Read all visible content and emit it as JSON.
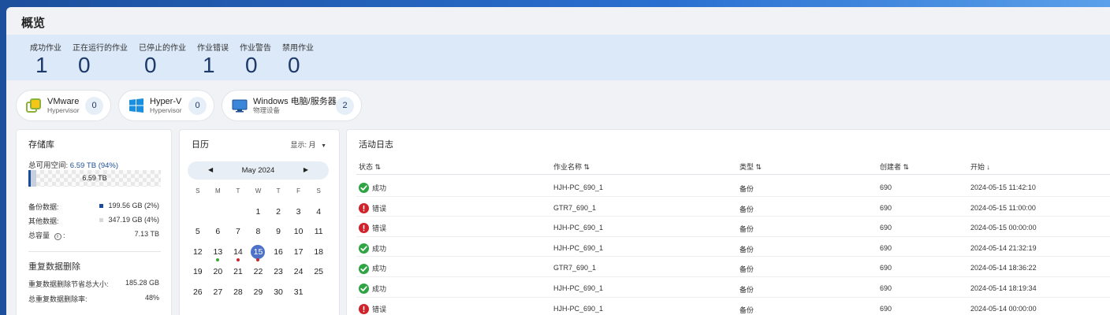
{
  "page": {
    "title": "概览"
  },
  "summary": [
    {
      "label": "成功作业",
      "value": "1"
    },
    {
      "label": "正在运行的作业",
      "value": "0"
    },
    {
      "label": "已停止的作业",
      "value": "0"
    },
    {
      "label": "作业错误",
      "value": "1"
    },
    {
      "label": "作业警告",
      "value": "0"
    },
    {
      "label": "禁用作业",
      "value": "0"
    }
  ],
  "hypervisors": [
    {
      "name": "VMware",
      "sub": "Hypervisor",
      "count": "0",
      "icon": "vmware-icon"
    },
    {
      "name": "Hyper-V",
      "sub": "Hypervisor",
      "count": "0",
      "icon": "windows-icon"
    },
    {
      "name": "Windows 电脑/服务器",
      "sub": "物理设备",
      "count": "2",
      "icon": "monitor-icon"
    }
  ],
  "storage": {
    "title": "存储库",
    "free_label": "总可用空间:",
    "free_value": "6.59 TB (94%)",
    "bar_text": "6.59 TB",
    "backup_fraction": 0.02,
    "other_fraction": 0.04,
    "backup_label": "备份数据:",
    "backup_value": "199.56 GB (2%)",
    "other_label": "其他数据:",
    "other_value": "347.19 GB (4%)",
    "total_label": "总容量",
    "total_value": "7.13 TB",
    "dedup_title": "重复数据删除",
    "dedup_saved_label": "重复数据删除节省总大小:",
    "dedup_saved_value": "185.28 GB",
    "dedup_rate_label": "总重复数据删除率:",
    "dedup_rate_value": "48%",
    "colors": {
      "backup": "#1a4c9b",
      "other": "#c7d0dc"
    }
  },
  "calendar": {
    "title": "日历",
    "display_label": "显示: 月",
    "month": "May 2024",
    "weekdays": [
      "S",
      "M",
      "T",
      "W",
      "T",
      "F",
      "S"
    ],
    "weeks": [
      [
        "",
        "",
        "",
        "1",
        "2",
        "3",
        "4"
      ],
      [
        "5",
        "6",
        "7",
        "8",
        "9",
        "10",
        "11"
      ],
      [
        "12",
        "13",
        "14",
        "15",
        "16",
        "17",
        "18"
      ],
      [
        "19",
        "20",
        "21",
        "22",
        "23",
        "24",
        "25"
      ],
      [
        "26",
        "27",
        "28",
        "29",
        "30",
        "31",
        ""
      ]
    ],
    "today": "15",
    "markers": {
      "13": "#3aa635",
      "14": "#c8252c",
      "15": "#c8252c"
    }
  },
  "activity": {
    "title": "活动日志",
    "columns": [
      "状态 ⇅",
      "作业名称 ⇅",
      "类型 ⇅",
      "创建者 ⇅",
      "开始 ↓"
    ],
    "rows": [
      {
        "status": "成功",
        "ok": true,
        "job": "HJH-PC_690_1",
        "type": "备份",
        "creator": "690",
        "start": "2024-05-15 11:42:10"
      },
      {
        "status": "错误",
        "ok": false,
        "job": "GTR7_690_1",
        "type": "备份",
        "creator": "690",
        "start": "2024-05-15 11:00:00"
      },
      {
        "status": "错误",
        "ok": false,
        "job": "HJH-PC_690_1",
        "type": "备份",
        "creator": "690",
        "start": "2024-05-15 00:00:00"
      },
      {
        "status": "成功",
        "ok": true,
        "job": "HJH-PC_690_1",
        "type": "备份",
        "creator": "690",
        "start": "2024-05-14 21:32:19"
      },
      {
        "status": "成功",
        "ok": true,
        "job": "GTR7_690_1",
        "type": "备份",
        "creator": "690",
        "start": "2024-05-14 18:36:22"
      },
      {
        "status": "成功",
        "ok": true,
        "job": "HJH-PC_690_1",
        "type": "备份",
        "creator": "690",
        "start": "2024-05-14 18:19:34"
      },
      {
        "status": "错误",
        "ok": false,
        "job": "HJH-PC_690_1",
        "type": "备份",
        "creator": "690",
        "start": "2024-05-14 00:00:00"
      }
    ],
    "colors": {
      "success": "#2ea443",
      "error": "#d0222b"
    }
  }
}
